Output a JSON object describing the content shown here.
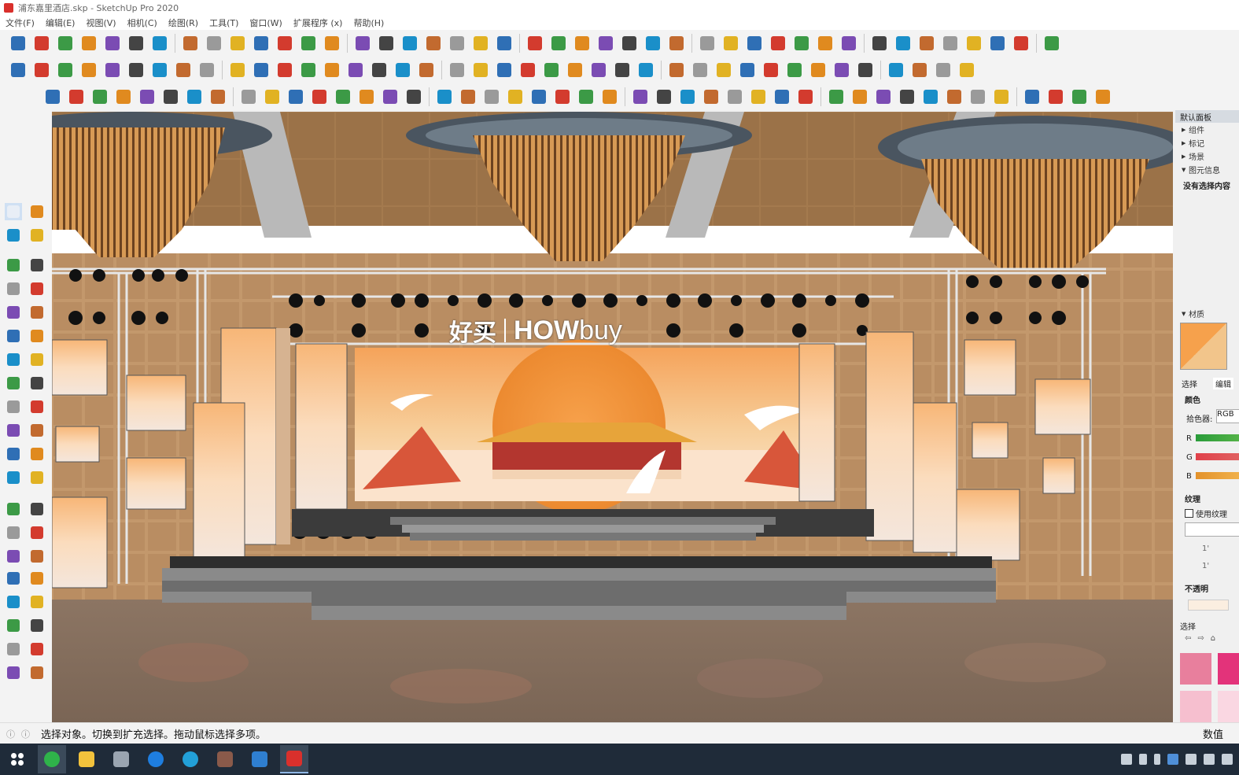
{
  "window": {
    "title": "浦东嘉里酒店.skp - SketchUp Pro 2020"
  },
  "menu": [
    "文件(F)",
    "编辑(E)",
    "视图(V)",
    "相机(C)",
    "绘图(R)",
    "工具(T)",
    "窗口(W)",
    "扩展程序 (x)",
    "帮助(H)"
  ],
  "scene": {
    "logo_cn": "好买",
    "logo_en_bold": "HOW",
    "logo_en_light": "buy"
  },
  "panel": {
    "title": "默认面板",
    "trays": [
      {
        "label": "组件",
        "open": false
      },
      {
        "label": "标记",
        "open": false
      },
      {
        "label": "场景",
        "open": false
      },
      {
        "label": "图元信息",
        "open": true
      }
    ],
    "entity_info_text": "没有选择内容",
    "materials_title": "材质",
    "tab_select": "选择",
    "tab_edit": "编辑",
    "color_label": "颜色",
    "picker_label": "拾色器:",
    "picker_value": "RGB",
    "r_label": "R",
    "g_label": "G",
    "b_label": "B",
    "texture_label": "纹理",
    "use_texture_label": "使用纹理",
    "opacity_label": "不透明",
    "select_label": "选择",
    "dim_w": "1'",
    "dim_h": "1'"
  },
  "status": {
    "text": "选择对象。切换到扩充选择。拖动鼠标选择多项。",
    "measure_label": "数值"
  },
  "colors": {
    "accent": "#2f6fb5",
    "material_swatch": "#e8963b",
    "swatch_a": "#e87f9d",
    "swatch_b": "#e3337a",
    "swatch_c": "#f6bfcf",
    "swatch_d": "#fad7e2"
  },
  "toolbar_icons": {
    "row1": [
      "box-icon",
      "eraser-icon",
      "box-outline-icon",
      "face-icon",
      "component-icon",
      "layers-icon",
      "paint-icon",
      "pushpull-icon",
      "cube-front-icon",
      "home-icon",
      "cube-top-icon",
      "house-icon",
      "cube-back-icon",
      "warehouse-icon",
      "extension-icon",
      "open-icon",
      "save-icon",
      "cut-icon",
      "copy-icon",
      "paste-icon",
      "delete-icon",
      "undo-icon",
      "redo-icon",
      "print-icon",
      "gem-icon",
      "clapper-icon",
      "monitor-icon",
      "arrows-icon",
      "target-icon",
      "axes-icon",
      "curve-icon",
      "bomb-icon",
      "arc-icon",
      "bezier-icon",
      "spline-icon",
      "hatch-icon",
      "freehand-icon",
      "ring-icon",
      "ring2-icon",
      "s-icon",
      "a-icon",
      "frame-icon",
      "leaf-icon"
    ],
    "row2": [
      "sandbox-icon",
      "arrow-down-icon",
      "arrow-blue-icon",
      "arrow-red-icon",
      "arrow-green-icon",
      "arrow-brown-icon",
      "arrow-orange-icon",
      "arrow-pink-icon",
      "flask-icon",
      "rotate-arc-icon",
      "tape-icon",
      "fence-icon",
      "stairs-icon",
      "warning-icon",
      "red-square-icon",
      "rope-icon",
      "pencil-icon",
      "arc2-icon",
      "corner-icon",
      "stamp-icon",
      "hook-icon",
      "scissors-icon",
      "gradient-icon",
      "bracket-icon",
      "curve2-icon",
      "sphere-icon",
      "fan-icon",
      "bars-icon",
      "shape-icon",
      "spiral-icon",
      "spiral2-icon",
      "flag-icon",
      "cube-orange-icon",
      "cube-yellow-icon",
      "cube-white-icon",
      "red-bar-icon",
      "wand-icon",
      "green-cube-icon",
      "green-cube2-icon",
      "green-cube3-icon"
    ],
    "row3": [
      "shield-icon",
      "refresh-icon",
      "car-icon",
      "flashlight-icon",
      "camera-icon",
      "projector-icon",
      "shield-plus-icon",
      "tree-icon",
      "film-icon",
      "speaker-icon",
      "sliders-icon",
      "sliders2-icon",
      "chat-icon",
      "info-icon",
      "import-icon",
      "export-icon",
      "exe-icon",
      "web-icon",
      "grid-icon",
      "grid2-icon",
      "grid3-icon",
      "grid4-icon",
      "pano-icon",
      "pano2-icon",
      "globe-icon",
      "move-icon",
      "cube-blue-icon",
      "cube-blue2-icon",
      "cube-blue3-icon",
      "prism-icon",
      "prism2-icon",
      "prism3-icon",
      "tetra-icon",
      "cylinder-icon",
      "circle-icon",
      "cup-icon",
      "drop-icon",
      "ellipse-icon",
      "diamond-icon",
      "oval-icon",
      "poly-icon",
      "ball-icon",
      "blob-icon",
      "magnet-icon"
    ]
  }
}
